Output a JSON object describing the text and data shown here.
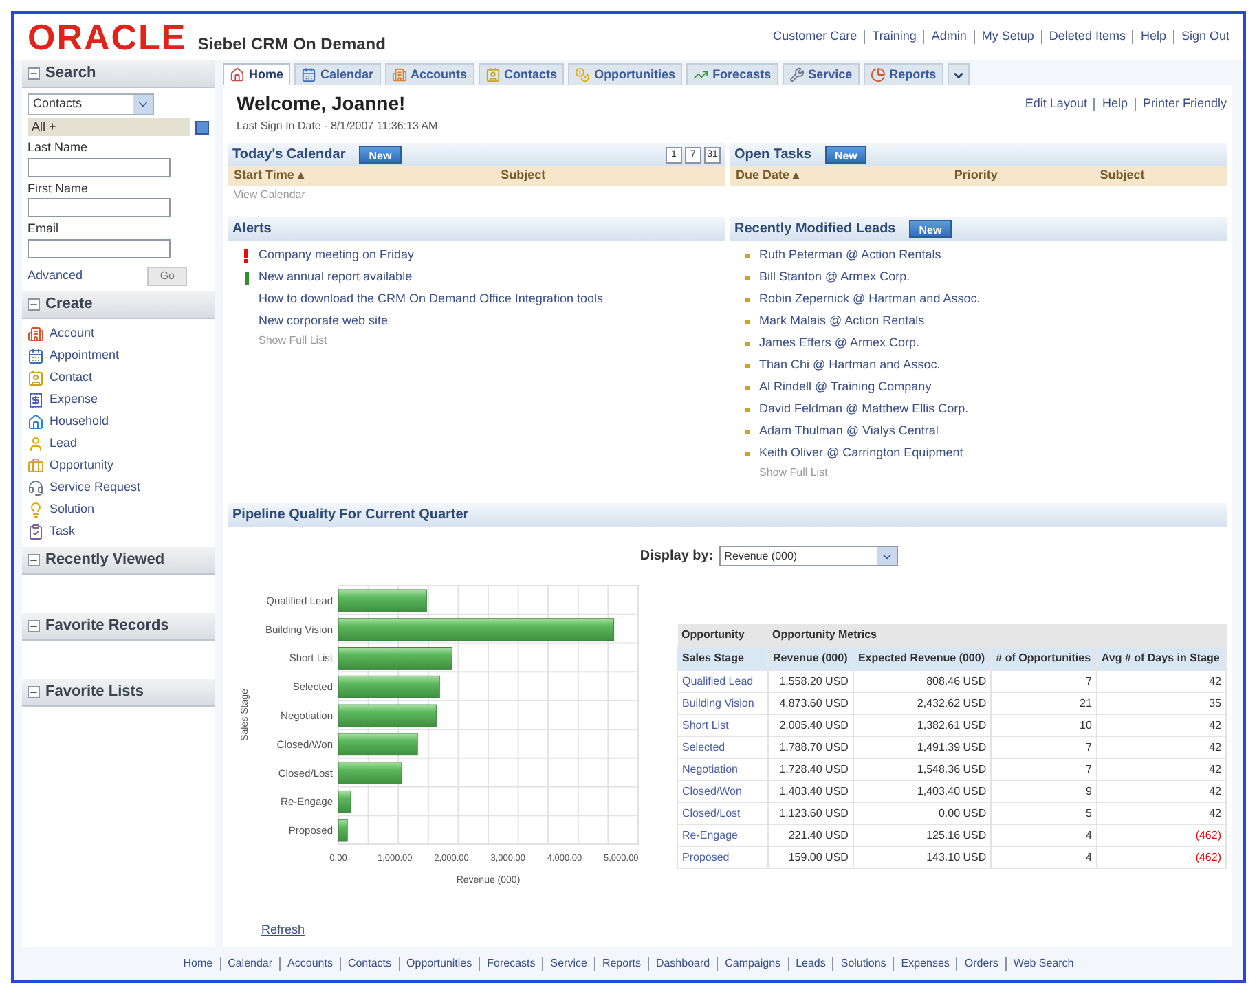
{
  "header": {
    "logo": "ORACLE",
    "product": "Siebel CRM On Demand",
    "links": [
      "Customer Care",
      "Training",
      "Admin",
      "My Setup",
      "Deleted Items",
      "Help",
      "Sign Out"
    ]
  },
  "tabs": [
    {
      "label": "Home",
      "selected": true
    },
    {
      "label": "Calendar",
      "selected": false
    },
    {
      "label": "Accounts",
      "selected": false
    },
    {
      "label": "Contacts",
      "selected": false
    },
    {
      "label": "Opportunities",
      "selected": false
    },
    {
      "label": "Forecasts",
      "selected": false
    },
    {
      "label": "Service",
      "selected": false
    },
    {
      "label": "Reports",
      "selected": false
    }
  ],
  "sidebar": {
    "search": {
      "title": "Search",
      "object": "Contacts",
      "filter": "All +",
      "fields": [
        "Last Name",
        "First Name",
        "Email"
      ],
      "advanced": "Advanced",
      "go": "Go"
    },
    "create": {
      "title": "Create",
      "items": [
        "Account",
        "Appointment",
        "Contact",
        "Expense",
        "Household",
        "Lead",
        "Opportunity",
        "Service Request",
        "Solution",
        "Task"
      ]
    },
    "sections": [
      "Recently Viewed",
      "Favorite Records",
      "Favorite Lists"
    ]
  },
  "welcome": {
    "title": "Welcome, Joanne!",
    "last_sign_in": "Last Sign In Date - 8/1/2007 11:36:13 AM",
    "links": [
      "Edit Layout",
      "Help",
      "Printer Friendly"
    ]
  },
  "calendar": {
    "title": "Today's Calendar",
    "new": "New",
    "view_buttons": [
      "1",
      "7",
      "31"
    ],
    "columns": [
      "Start Time ▴",
      "Subject"
    ],
    "footer": "View Calendar"
  },
  "open_tasks": {
    "title": "Open Tasks",
    "new": "New",
    "columns": [
      "Due Date ▴",
      "Priority",
      "Subject"
    ]
  },
  "alerts": {
    "title": "Alerts",
    "items": [
      {
        "text": "Company meeting on Friday",
        "kind": "urgent"
      },
      {
        "text": "New annual report available",
        "kind": "info"
      },
      {
        "text": "How to download the CRM On Demand Office Integration tools",
        "kind": "plain"
      },
      {
        "text": "New corporate web site",
        "kind": "plain"
      }
    ],
    "footer": "Show Full List"
  },
  "leads": {
    "title": "Recently Modified Leads",
    "new": "New",
    "items": [
      "Ruth Peterman @ Action Rentals",
      "Bill Stanton @ Armex Corp.",
      "Robin Zepernick @ Hartman and Assoc.",
      "Mark Malais @ Action Rentals",
      "James Effers @ Armex Corp.",
      "Than Chi @ Hartman and Assoc.",
      "Al Rindell @ Training Company",
      "David Feldman @ Matthew Ellis Corp.",
      "Adam Thulman @ Vialys Central",
      "Keith Oliver @ Carrington Equipment"
    ],
    "footer": "Show Full List"
  },
  "pipeline": {
    "title": "Pipeline Quality For Current Quarter",
    "display_by_label": "Display by:",
    "display_by": "Revenue (000)",
    "chart_data": {
      "type": "bar",
      "orientation": "horizontal",
      "xlabel": "Revenue (000)",
      "ylabel": "Sales Stage",
      "categories": [
        "Qualified Lead",
        "Building Vision",
        "Short List",
        "Selected",
        "Negotiation",
        "Closed/Won",
        "Closed/Lost",
        "Re-Engage",
        "Proposed"
      ],
      "values": [
        1560,
        4870,
        2010,
        1790,
        1730,
        1400,
        1120,
        220,
        160
      ],
      "xlim": [
        0,
        5300
      ],
      "xticks": [
        {
          "value": 0,
          "label": "0.00"
        },
        {
          "value": 1000,
          "label": "1,000.00"
        },
        {
          "value": 2000,
          "label": "2,000.00"
        },
        {
          "value": 3000,
          "label": "3,000.00"
        },
        {
          "value": 4000,
          "label": "4,000.00"
        },
        {
          "value": 5000,
          "label": "5,000.00"
        }
      ]
    },
    "table": {
      "group_headers": [
        "Opportunity",
        "Opportunity Metrics"
      ],
      "columns": [
        "Sales Stage",
        "Revenue (000)",
        "Expected Revenue (000)",
        "# of Opportunities",
        "Avg # of Days in Stage"
      ],
      "rows": [
        {
          "cells": [
            "Qualified Lead",
            "1,558.20 USD",
            "808.46 USD",
            "7",
            "42"
          ],
          "negative": false
        },
        {
          "cells": [
            "Building Vision",
            "4,873.60 USD",
            "2,432.62 USD",
            "21",
            "35"
          ],
          "negative": false
        },
        {
          "cells": [
            "Short List",
            "2,005.40 USD",
            "1,382.61 USD",
            "10",
            "42"
          ],
          "negative": false
        },
        {
          "cells": [
            "Selected",
            "1,788.70 USD",
            "1,491.39 USD",
            "7",
            "42"
          ],
          "negative": false
        },
        {
          "cells": [
            "Negotiation",
            "1,728.40 USD",
            "1,548.36 USD",
            "7",
            "42"
          ],
          "negative": false
        },
        {
          "cells": [
            "Closed/Won",
            "1,403.40 USD",
            "1,403.40 USD",
            "9",
            "42"
          ],
          "negative": false
        },
        {
          "cells": [
            "Closed/Lost",
            "1,123.60 USD",
            "0.00 USD",
            "5",
            "42"
          ],
          "negative": false
        },
        {
          "cells": [
            "Re-Engage",
            "221.40 USD",
            "125.16 USD",
            "4",
            "(462)"
          ],
          "negative": true
        },
        {
          "cells": [
            "Proposed",
            "159.00 USD",
            "143.10 USD",
            "4",
            "(462)"
          ],
          "negative": true
        }
      ]
    },
    "refresh": "Refresh"
  },
  "footer_links": [
    "Home",
    "Calendar",
    "Accounts",
    "Contacts",
    "Opportunities",
    "Forecasts",
    "Service",
    "Reports",
    "Dashboard",
    "Campaigns",
    "Leads",
    "Solutions",
    "Expenses",
    "Orders",
    "Web Search"
  ]
}
